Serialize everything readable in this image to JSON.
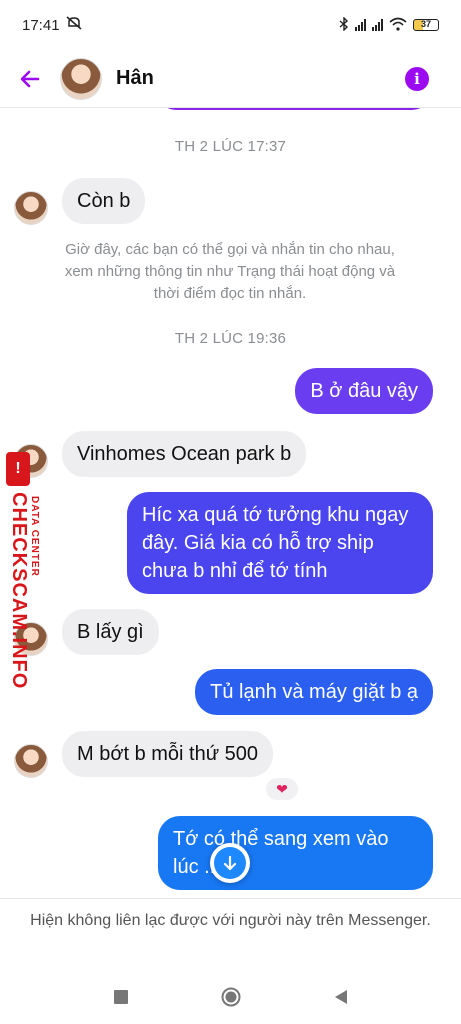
{
  "status_bar": {
    "time": "17:41",
    "battery": "37"
  },
  "header": {
    "contact_name": "Hân",
    "icons": [
      "back-arrow-icon",
      "info-icon"
    ],
    "accent_color": "#9b0af0"
  },
  "chat": {
    "timestamp_1": "TH 2 LÚC 17:37",
    "system_message": "Giờ đây, các bạn có thể gọi và nhắn tin cho nhau, xem những thông tin như Trạng thái hoạt động và thời điểm đọc tin nhắn.",
    "timestamp_2": "TH 2 LÚC 19:36",
    "messages": [
      {
        "sender": "them",
        "text": "Còn b"
      },
      {
        "sender": "me",
        "text": "B ở đâu vậy",
        "color": "#6a3ef0"
      },
      {
        "sender": "them",
        "text": "Vinhomes Ocean park b"
      },
      {
        "sender": "me",
        "text": "Híc xa quá tớ tưởng khu ngay đây. Giá kia có hỗ trợ ship chưa b nhỉ để tớ tính",
        "color": "#4a45ee"
      },
      {
        "sender": "them",
        "text": "B lấy gì"
      },
      {
        "sender": "me",
        "text": "Tủ lạnh và máy giặt b ạ",
        "color": "#2a5ff0"
      },
      {
        "sender": "them",
        "text": "M bớt b mỗi thứ 500",
        "reaction": "❤"
      },
      {
        "sender": "me",
        "text": "Tớ có thể sang xem vào lúc ... đc",
        "color": "#1877f2"
      }
    ]
  },
  "watermark": {
    "brand": "CHECKSCAM.INFO",
    "sub": "DATA CENTER"
  },
  "footer": {
    "notice": "Hiện không liên lạc được với người này trên Messenger."
  },
  "nav": {
    "icons": [
      "recents-icon",
      "home-icon",
      "back-icon"
    ]
  }
}
